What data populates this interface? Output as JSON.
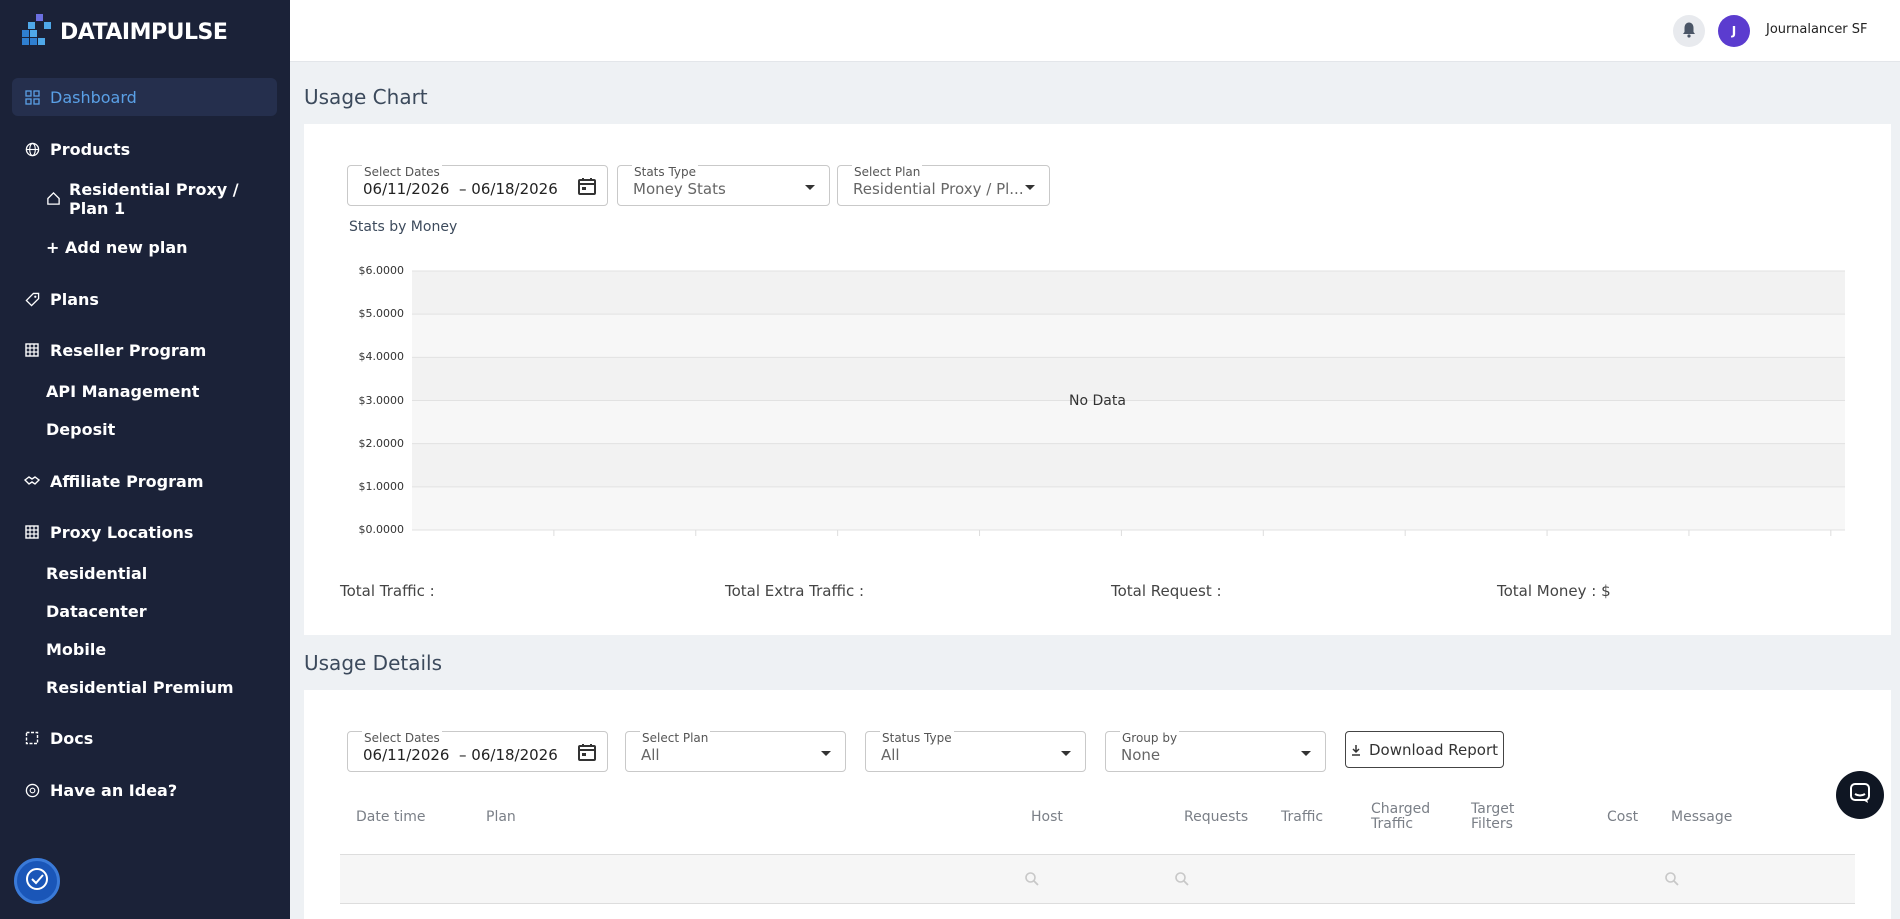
{
  "brand": {
    "name": "DATAIMPULSE"
  },
  "sidebar": {
    "items": [
      {
        "label": "Dashboard",
        "icon": "dashboard-icon"
      },
      {
        "label": "Products",
        "icon": "globe-icon"
      },
      {
        "label": "Plans",
        "icon": "tag-icon"
      },
      {
        "label": "Reseller Program",
        "icon": "grid-icon"
      },
      {
        "label": "Affiliate Program",
        "icon": "handshake-icon"
      },
      {
        "label": "Proxy Locations",
        "icon": "grid-icon"
      },
      {
        "label": "Docs",
        "icon": "docs-icon"
      },
      {
        "label": "Have an Idea?",
        "icon": "idea-icon"
      }
    ],
    "products_sub": {
      "plan_line1": "Residential Proxy /",
      "plan_line2": "Plan 1",
      "add_plan": "+ Add new plan"
    },
    "reseller_sub": [
      "API Management",
      "Deposit"
    ],
    "locations_sub": [
      "Residential",
      "Datacenter",
      "Mobile",
      "Residential Premium"
    ]
  },
  "topbar": {
    "avatar_initial": "J",
    "username": "Journalancer SF"
  },
  "usage_chart": {
    "title": "Usage Chart",
    "date_label": "Select Dates",
    "date_start": "06/11/2026",
    "date_sep": "–",
    "date_end": "06/18/2026",
    "stats_type_label": "Stats Type",
    "stats_type_value": "Money Stats",
    "plan_label": "Select Plan",
    "plan_value": "Residential Proxy / Pl...",
    "chart_subtitle": "Stats by Money",
    "no_data": "No Data",
    "totals": {
      "traffic": "Total Traffic :",
      "extra_traffic": "Total Extra Traffic :",
      "request": "Total Request :",
      "money": "Total Money : $"
    }
  },
  "chart_data": {
    "type": "bar",
    "title": "Stats by Money",
    "categories": [],
    "values": [],
    "y_ticks": [
      "$6.0000",
      "$5.0000",
      "$4.0000",
      "$3.0000",
      "$2.0000",
      "$1.0000",
      "$0.0000"
    ],
    "ylim": [
      0,
      6
    ],
    "grid": true,
    "annotation": "No Data"
  },
  "usage_details": {
    "title": "Usage Details",
    "date_label": "Select Dates",
    "date_start": "06/11/2026",
    "date_sep": "–",
    "date_end": "06/18/2026",
    "plan_label": "Select Plan",
    "plan_value": "All",
    "status_label": "Status Type",
    "status_value": "All",
    "group_label": "Group by",
    "group_value": "None",
    "download_label": "Download Report",
    "columns": {
      "datetime": "Date time",
      "plan": "Plan",
      "host": "Host",
      "requests": "Requests",
      "traffic": "Traffic",
      "charged_1": "Charged",
      "charged_2": "Traffic",
      "target_1": "Target",
      "target_2": "Filters",
      "cost": "Cost",
      "message": "Message"
    }
  },
  "colors": {
    "sidebar_bg": "#1b2238",
    "accent": "#5aa0e6",
    "avatar": "#5b3ccf"
  }
}
